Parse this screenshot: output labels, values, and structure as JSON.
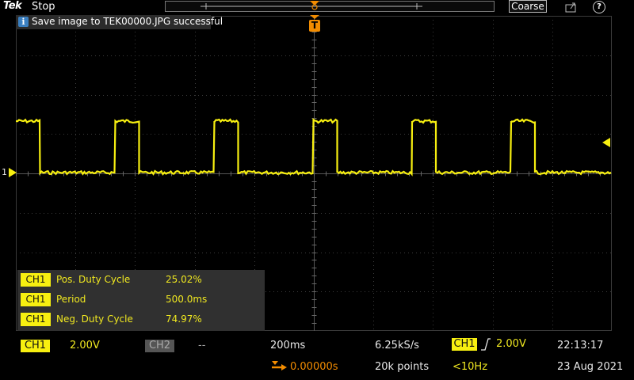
{
  "header": {
    "brand": "Tek",
    "acq_state": "Stop",
    "coarse_label": "Coarse",
    "help_label": "?"
  },
  "notification": {
    "icon": "info-icon",
    "icon_glyph": "i",
    "text": "Save image to TEK00000.JPG successful"
  },
  "channel_marker": {
    "label": "1"
  },
  "trigger_marker": {
    "label": "T"
  },
  "measurements": [
    {
      "source": "CH1",
      "name": "Pos. Duty Cycle",
      "value": "25.02%"
    },
    {
      "source": "CH1",
      "name": "Period",
      "value": "500.0ms"
    },
    {
      "source": "CH1",
      "name": "Neg. Duty Cycle",
      "value": "74.97%"
    }
  ],
  "status": {
    "ch1_label": "CH1",
    "ch1_scale": "2.00V",
    "ch2_label": "CH2",
    "ch2_scale": "--",
    "timebase": "200ms",
    "horizontal_position": "0.00000s",
    "sample_rate": "6.25kS/s",
    "record_length": "20k points",
    "trigger_source": "CH1",
    "trigger_level": "2.00V",
    "trigger_frequency": "<10Hz",
    "time": "22:13:17",
    "date": "23 Aug 2021"
  },
  "colors": {
    "ch1": "#f7ef10",
    "trigger": "#f28c00",
    "info": "#3a7fc0"
  }
}
